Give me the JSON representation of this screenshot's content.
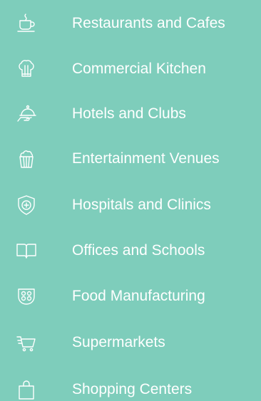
{
  "theme": {
    "background": "#7ecdbb",
    "foreground": "#ffffff"
  },
  "categories": [
    {
      "label": "Restaurants and Cafes",
      "icon": "coffee-cup-icon"
    },
    {
      "label": "Commercial Kitchen",
      "icon": "chef-hat-icon"
    },
    {
      "label": "Hotels and Clubs",
      "icon": "serving-cloche-icon"
    },
    {
      "label": "Entertainment Venues",
      "icon": "popcorn-icon"
    },
    {
      "label": "Hospitals and Clinics",
      "icon": "medical-shield-icon"
    },
    {
      "label": "Offices and Schools",
      "icon": "open-book-icon"
    },
    {
      "label": "Food Manufacturing",
      "icon": "food-tray-icon"
    },
    {
      "label": "Supermarkets",
      "icon": "shopping-cart-icon"
    },
    {
      "label": "Shopping Centers",
      "icon": "shopping-bag-icon"
    }
  ]
}
